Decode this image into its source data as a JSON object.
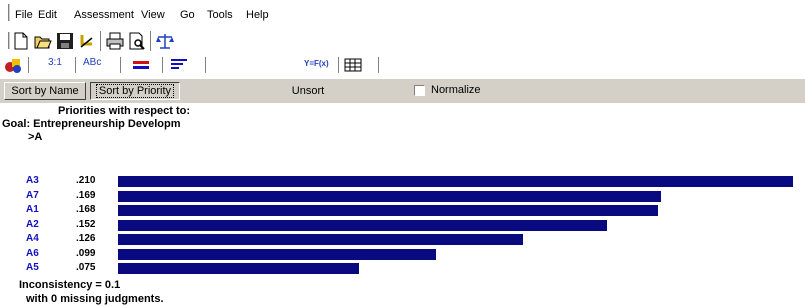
{
  "menu": {
    "items": [
      {
        "label": "File"
      },
      {
        "label": "Edit"
      },
      {
        "label": "Assessment"
      },
      {
        "label": "View"
      },
      {
        "label": "Go"
      },
      {
        "label": "Tools"
      },
      {
        "label": "Help"
      }
    ]
  },
  "toolbar2": {
    "ratio_label": "3:1",
    "abc_label": "ABc",
    "formula_label": "Y=F(x)"
  },
  "toolbar3": {
    "sort_name": "Sort by Name",
    "sort_priority": "Sort by Priority",
    "unsort": "Unsort",
    "normalize": "Normalize"
  },
  "content": {
    "heading": "Priorities with respect to:",
    "goal": "Goal: Entrepreneurship Developm",
    "node": ">A",
    "inconsistency": "Inconsistency = 0.1",
    "missing": "with 0  missing judgments."
  },
  "chart_data": {
    "type": "bar",
    "categories": [
      "A3",
      "A7",
      "A1",
      "A2",
      "A4",
      "A6",
      "A5"
    ],
    "values": [
      0.21,
      0.169,
      0.168,
      0.152,
      0.126,
      0.099,
      0.075
    ],
    "value_labels": [
      ".210",
      ".169",
      ".168",
      ".152",
      ".126",
      ".099",
      ".075"
    ],
    "bar_color": "#0a0a80",
    "label_color": "#1010c0"
  }
}
